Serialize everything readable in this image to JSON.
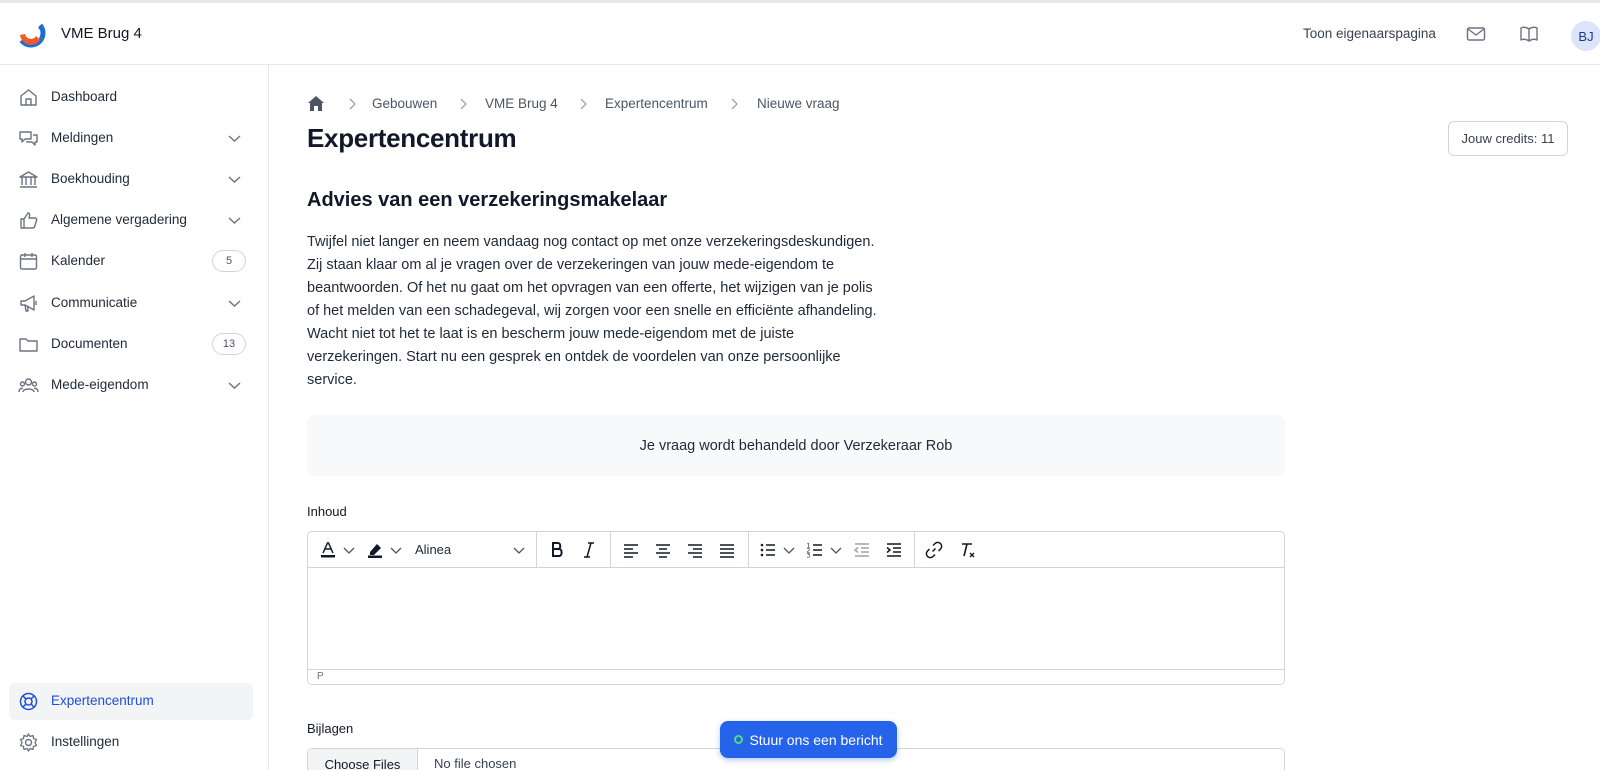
{
  "app": {
    "title": "VME Brug 4",
    "owner_page_link": "Toon eigenaarspagina",
    "avatar_initials": "BJ",
    "brand_colors": {
      "orange": "#f05a28",
      "blue": "#1f6fd1",
      "accent": "#2563eb"
    }
  },
  "sidebar": {
    "items": [
      {
        "label": "Dashboard",
        "icon": "home-icon"
      },
      {
        "label": "Meldingen",
        "icon": "chat-bubbles-icon",
        "expandable": true
      },
      {
        "label": "Boekhouding",
        "icon": "bank-icon",
        "expandable": true
      },
      {
        "label": "Algemene vergadering",
        "icon": "thumbs-up-icon",
        "expandable": true
      },
      {
        "label": "Kalender",
        "icon": "calendar-icon",
        "count": "5"
      },
      {
        "label": "Communicatie",
        "icon": "megaphone-icon",
        "expandable": true
      },
      {
        "label": "Documenten",
        "icon": "folder-icon",
        "count": "13"
      },
      {
        "label": "Mede-eigendom",
        "icon": "users-icon",
        "expandable": true
      }
    ],
    "bottom_items": [
      {
        "label": "Expertencentrum",
        "icon": "lifebuoy-icon",
        "active": true
      },
      {
        "label": "Instellingen",
        "icon": "gear-icon"
      }
    ]
  },
  "breadcrumb": [
    "Gebouwen",
    "VME Brug 4",
    "Expertencentrum",
    "Nieuwe vraag"
  ],
  "page": {
    "title": "Expertencentrum",
    "credits": "Jouw credits: 11",
    "section_title": "Advies van een verzekeringsmakelaar",
    "intro_lines": [
      "Twijfel niet langer en neem vandaag nog contact op met onze verzekeringsdeskundigen.",
      "Zij staan klaar om al je vragen over de verzekeringen van jouw mede-eigendom te",
      "beantwoorden. Of het nu gaat om het opvragen van een offerte, het wijzigen van je polis",
      "of het melden van een schadegeval, wij zorgen voor een snelle en efficiënte afhandeling.",
      "Wacht niet tot het te laat is en bescherm jouw mede-eigendom met de juiste",
      "verzekeringen. Start nu een gesprek en ontdek de voordelen van onze persoonlijke",
      "service."
    ],
    "handled_by": "Je vraag wordt behandeld door Verzekeraar Rob"
  },
  "form": {
    "content_label": "Inhoud",
    "paragraph_select": "Alinea",
    "status_path": "P",
    "attachments_label": "Bijlagen",
    "file_button": "Choose Files",
    "file_status": "No file chosen"
  },
  "chat": {
    "label": "Stuur ons een bericht"
  }
}
